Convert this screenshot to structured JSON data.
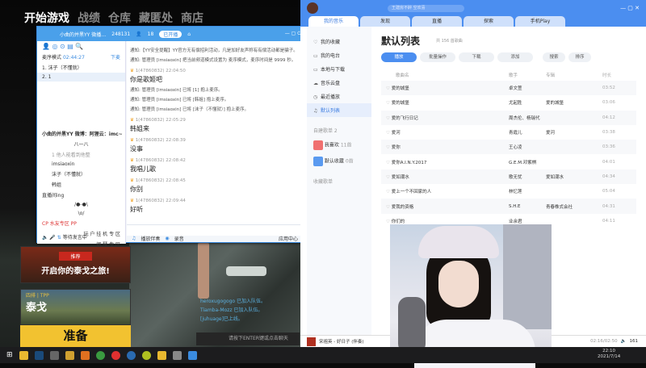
{
  "game": {
    "menu": [
      "开始游戏",
      "战绩",
      "仓库",
      "藏匿处",
      "商店"
    ],
    "recommend_tag": "推荐",
    "recommend_text": "开启你的泰戈之旅!",
    "map_mode": "四排 | TPP",
    "map_name": "泰戈",
    "ready": "准备",
    "team_feed": [
      "heroxugogogo 已加入队伍。",
      "Tiamba-Mozz 已加入队伍。",
      "[juhuage]已上线。"
    ],
    "chat_hint": "请按下ENTER键或点击聊天"
  },
  "yy": {
    "channel": "小曲的并黑YY 微播…",
    "id": "248131",
    "users": "18",
    "live_btn": "已开播",
    "mode": "麦序模式",
    "time": "02:44:27",
    "down": "下麦",
    "queue": [
      "1. 沫子（不懂就）",
      "2. 1"
    ],
    "tree": [
      "小曲的并黑YY 微博：阿狸云：imc~",
      "八一八",
      "1 他人能看到他整",
      "imsiaoxin",
      "沫子（不懂就）",
      "韩姐",
      "直播间ing",
      "/●-●\\",
      "\\o/",
      "CP 水友专区 PP",
      "玩 户 挂 机 专 区",
      "钢 琴 专 区"
    ],
    "notes": [
      "通知:【YY安全提醒】YY官方无有偿招利活动，凡是加好友声称有有偿活动都是骗子。",
      "通知: 管理员 [imsiaoxin] 把当前频道模式设置为 麦序模式，麦序时间是 9999 秒。"
    ],
    "messages": [
      {
        "type": "msg",
        "head": "1(47860832)  22:04:50",
        "body": "你是歌姬吧"
      },
      {
        "type": "note",
        "text": "通知: 管理员 [imsiaoxin] 已将 [1] 抱上麦序。"
      },
      {
        "type": "note",
        "text": "通知: 管理员 [imsiaoxin] 已将 [韩姐] 抱上麦序。"
      },
      {
        "type": "note",
        "text": "通知: 管理员 [imsiaoxin] 已将 [沫子（不懂就）] 抱上麦序。"
      },
      {
        "type": "msg",
        "head": "1(47860832)  22:05:29",
        "body": "韩姐来"
      },
      {
        "type": "msg",
        "head": "1(47860832)  22:08:39",
        "body": "没事"
      },
      {
        "type": "msg",
        "head": "1(47860832)  22:08:42",
        "body": "我唱儿歌"
      },
      {
        "type": "msg",
        "head": "1(47860832)  22:08:45",
        "body": "你别"
      },
      {
        "type": "msg",
        "head": "1(47860832)  22:09:44",
        "body": "好听"
      }
    ],
    "bottom": [
      "播放伴奏",
      "录音",
      "应用中心"
    ],
    "left_bottom": "等待发言中"
  },
  "music": {
    "search_placeholder": "王建房不醉 空欢喜",
    "tabs": [
      "我的音乐",
      "发现",
      "直播",
      "探索",
      "手机Play"
    ],
    "sidebar": [
      "我的收藏",
      "我的电台",
      "本地与下载",
      "音乐云盘",
      "最近播放",
      "默认列表"
    ],
    "custom_header": "自建歌单 2",
    "playlists": [
      {
        "name": "我喜欢",
        "count": "11首"
      },
      {
        "name": "默认收藏",
        "count": "0首"
      }
    ],
    "collect_header": "收藏歌单",
    "title": "默认列表",
    "count": "共 156 首歌曲",
    "tools": [
      "播放",
      "批量操作",
      "下载",
      "添加"
    ],
    "search": "搜索",
    "sort": "排序",
    "columns": [
      "歌曲名",
      "歌手",
      "专辑",
      "时长"
    ],
    "songs": [
      [
        "爱的城堡",
        "卓文萱",
        "",
        "03:52"
      ],
      [
        "爱的城堡",
        "尤起胜",
        "爱的城堡",
        "03:06"
      ],
      [
        "爱的飞行日记",
        "周杰伦、杨瑞代",
        "",
        "04:12"
      ],
      [
        "爱河",
        "青霞儿",
        "爱河",
        "03:38"
      ],
      [
        "爱你",
        "王心凌",
        "",
        "03:36"
      ],
      [
        "爱你A.I.N.Y.2017",
        "G.E.M.邓紫棋",
        "",
        "04:01"
      ],
      [
        "爱如潮水",
        "歌无忧",
        "爱如潮水",
        "04:34"
      ],
      [
        "爱上一个不回家的人",
        "林忆莲",
        "",
        "05:04"
      ],
      [
        "爱我的资格",
        "S.H.E",
        "青春株式会社",
        "04:31"
      ],
      [
        "你们的",
        "业余君",
        "",
        "04:11"
      ]
    ],
    "now_playing": "宋祖英 - 好日子 (伴奏)",
    "progress": "02:16/02:50",
    "queue_count": "161"
  },
  "taskbar": {
    "time": "22:10",
    "date": "2021/7/14"
  }
}
